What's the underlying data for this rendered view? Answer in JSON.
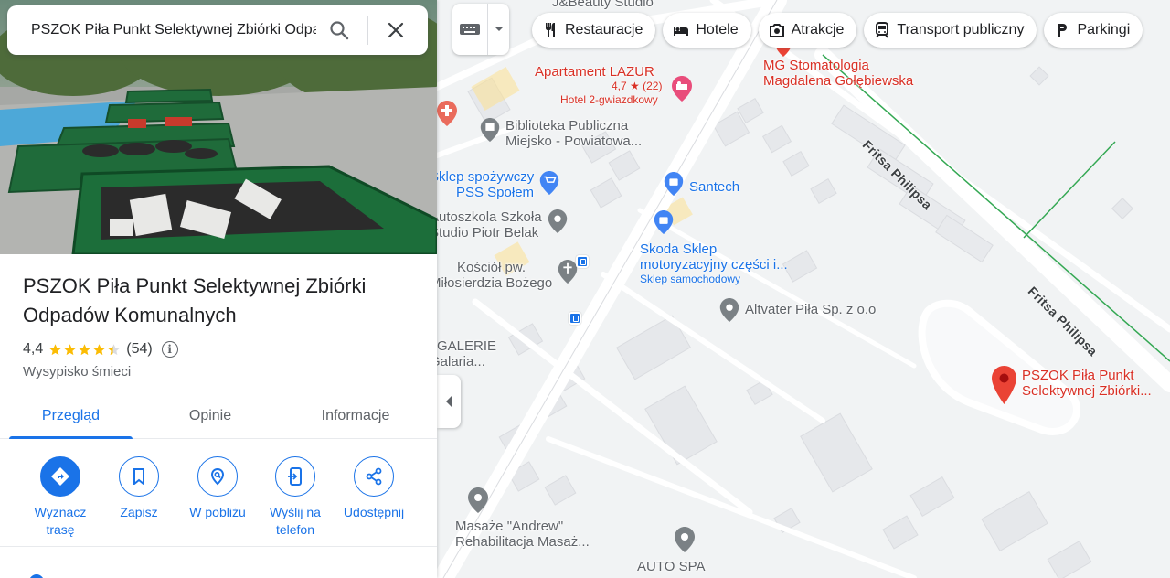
{
  "search": {
    "value": "PSZOK Piła Punkt Selektywnej Zbiórki Odpadów Komunalnych",
    "search_icon": "search-icon",
    "close_icon": "close-icon"
  },
  "place": {
    "title": "PSZOK Piła Punkt Selektywnej Zbiórki Odpadów Komunalnych",
    "rating": "4,4",
    "rating_value": 4.4,
    "reviews": "(54)",
    "category": "Wysypisko śmieci"
  },
  "tabs": [
    {
      "label": "Przegląd",
      "active": true
    },
    {
      "label": "Opinie",
      "active": false
    },
    {
      "label": "Informacje",
      "active": false
    }
  ],
  "actions": [
    {
      "label": "Wyznacz trasę",
      "icon": "directions-icon"
    },
    {
      "label": "Zapisz",
      "icon": "bookmark-icon"
    },
    {
      "label": "W pobliżu",
      "icon": "nearby-icon"
    },
    {
      "label": "Wyślij na telefon",
      "icon": "send-to-phone-icon"
    },
    {
      "label": "Udostępnij",
      "icon": "share-icon"
    }
  ],
  "chips": [
    {
      "label": "Restauracje",
      "icon": "restaurant-icon"
    },
    {
      "label": "Hotele",
      "icon": "hotel-icon"
    },
    {
      "label": "Atrakcje",
      "icon": "camera-icon"
    },
    {
      "label": "Transport publiczny",
      "icon": "transit-icon"
    },
    {
      "label": "Parkingi",
      "icon": "parking-icon"
    }
  ],
  "map": {
    "pois": {
      "jbeauty": "J&Beauty Studio",
      "apartament_name": "Apartament LAZUR",
      "apartament_rating": "4,7 ★ (22)",
      "apartament_sub": "Hotel 2-gwiazdkowy",
      "mg_line1": "MG Stomatologia",
      "mg_line2": "Magdalena Gołębiewska",
      "biblioteka_line1": "Biblioteka Publiczna",
      "biblioteka_line2": "Miejsko - Powiatowa...",
      "sklep_line1": "Sklep spożywczy",
      "sklep_line2": "PSS Społem",
      "santech": "Santech",
      "autoszkola_line1": "Autoszkola Szkoła",
      "autoszkola_line2": "Studio Piotr Belak",
      "skoda_line1": "Skoda Sklep",
      "skoda_line2": "motoryzacyjny części i...",
      "skoda_sub": "Sklep samochodowy",
      "kosciol_line1": "Kościół pw.",
      "kosciol_line2": "Miłosierdzia Bożego",
      "galeria_line1": "GALERIE",
      "galeria_line2": "Galaria...",
      "altvater": "Altvater Piła Sp. z o.o",
      "pszok_line1": "PSZOK Piła Punkt",
      "pszok_line2": "Selektywnej Zbiórki...",
      "masaze_line1": "Masaże \"Andrew\"",
      "masaze_line2": "Rehabilitacja Masaż...",
      "autospa": "AUTO SPA"
    },
    "roads": {
      "fritsa_1": "Fritsa Philipsa",
      "fritsa_2": "Fritsa Philipsa"
    },
    "colors": {
      "pin_red": "#ea4335",
      "poi_blue": "#1a73e8",
      "poi_grey": "#70757a",
      "route_green": "#34a853"
    }
  }
}
